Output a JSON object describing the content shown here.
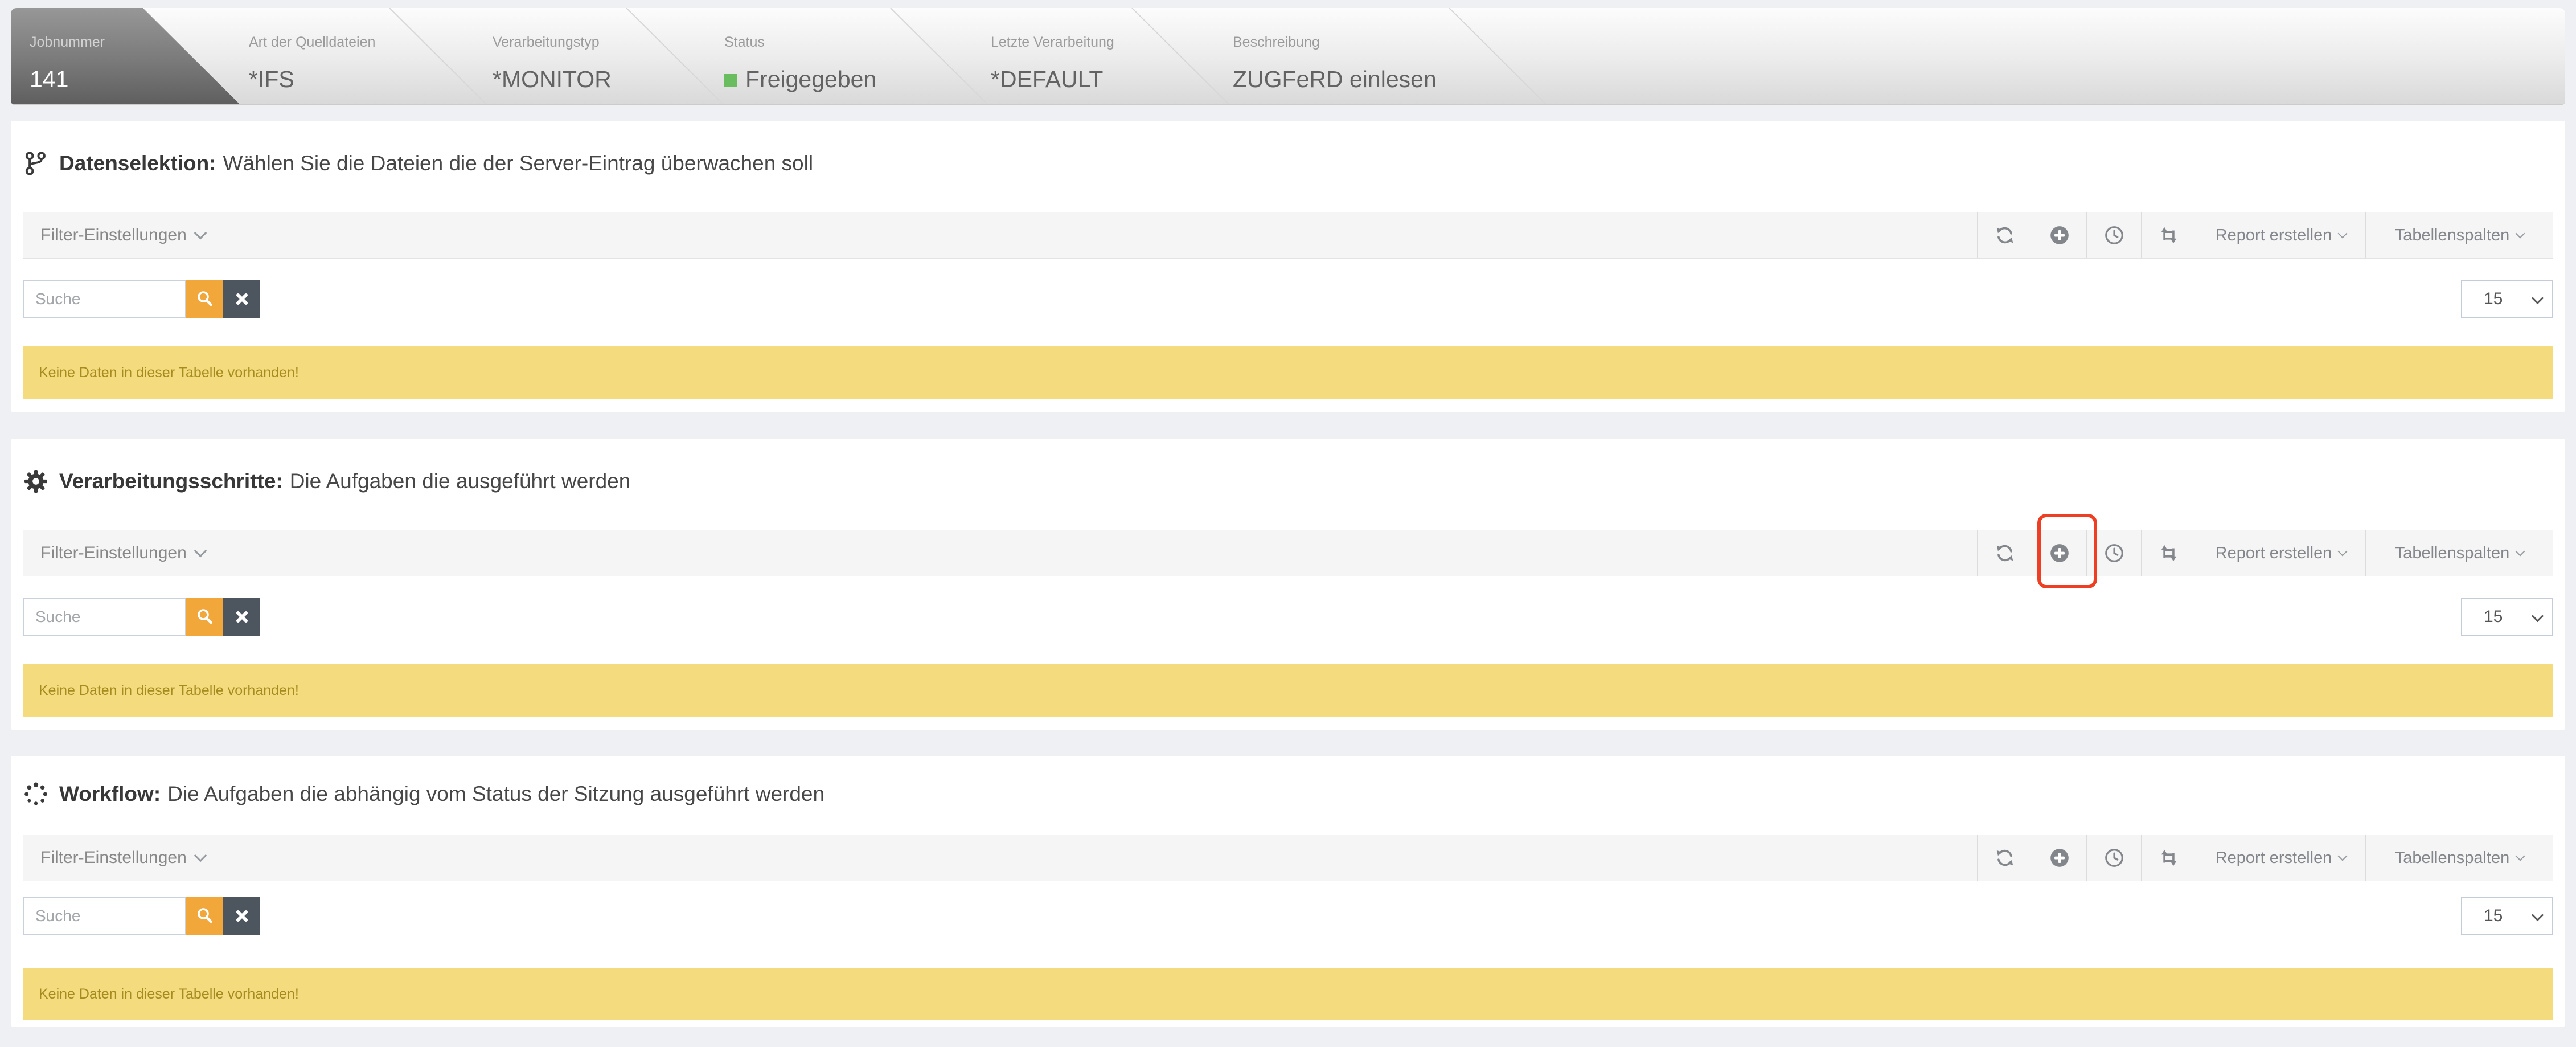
{
  "header": {
    "tabs": [
      {
        "label": "Jobnummer",
        "value": "141"
      },
      {
        "label": "Art der Quelldateien",
        "value": "*IFS"
      },
      {
        "label": "Verarbeitungstyp",
        "value": "*MONITOR"
      },
      {
        "label": "Status",
        "value": "Freigegeben"
      },
      {
        "label": "Letzte Verarbeitung",
        "value": "*DEFAULT"
      },
      {
        "label": "Beschreibung",
        "value": "ZUGFeRD einlesen"
      }
    ]
  },
  "panels": [
    {
      "icon": "code-branch-icon",
      "title": "Datenselektion:",
      "subtitle": "Wählen Sie die Dateien die der Server-Eintrag überwachen soll"
    },
    {
      "icon": "gear-icon",
      "title": "Verarbeitungsschritte:",
      "subtitle": "Die Aufgaben die ausgeführt werden"
    },
    {
      "icon": "spinner-icon",
      "title": "Workflow:",
      "subtitle": "Die Aufgaben die abhängig vom Status der Sitzung ausgeführt werden"
    }
  ],
  "table_controls": {
    "filter_label": "Filter-Einstellungen",
    "report_label": "Report erstellen",
    "columns_label": "Tabellenspalten",
    "search_placeholder": "Suche",
    "page_size": "15",
    "empty_message": "Keine Daten in dieser Tabelle vorhanden!"
  },
  "colors": {
    "page_bg": "#eef0f3",
    "accent_orange": "#f2a73b",
    "dark_button": "#4d565f",
    "status_green": "#6abd5e",
    "empty_bg": "#f4db7e",
    "empty_text": "#a68b1e",
    "highlight_red": "#ee3e23"
  }
}
